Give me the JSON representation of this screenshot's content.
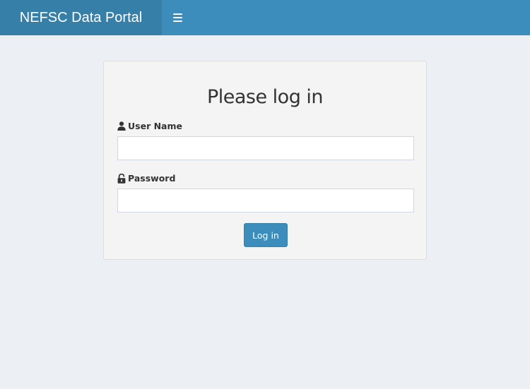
{
  "header": {
    "logo_text": "NEFSC Data Portal",
    "toggle_icon": "hamburger-menu-icon",
    "background_color": "#3c8dbc",
    "logo_background_color": "#367fa9"
  },
  "login": {
    "title": "Please log in",
    "username": {
      "label": "User Name",
      "icon": "user-icon",
      "value": "",
      "placeholder": ""
    },
    "password": {
      "label": "Password",
      "icon": "unlock-icon",
      "value": "",
      "placeholder": ""
    },
    "submit_label": "Log in",
    "button_color": "#3c8dbc"
  }
}
